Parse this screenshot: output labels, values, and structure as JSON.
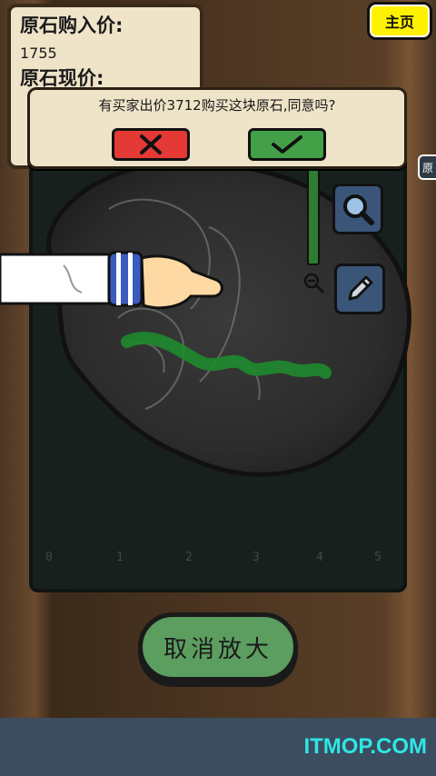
{
  "price_card": {
    "purchase_label": "原石购入价:",
    "purchase_value": "1755",
    "current_label": "原石现价:"
  },
  "home_button": {
    "label": "主页"
  },
  "side_tab": {
    "label": "原"
  },
  "dialog": {
    "message": "有买家出价3712购买这块原石,同意吗?"
  },
  "board": {
    "axis_labels": [
      "0",
      "1",
      "2",
      "3",
      "4",
      "5"
    ]
  },
  "cancel_zoom": {
    "label": "取消放大"
  },
  "footer": {
    "watermark": "ITMOP.COM"
  },
  "icons": {
    "reject": "close-icon",
    "accept": "checkmark-icon",
    "magnifier": "magnifier-icon",
    "pencil": "pencil-icon",
    "zoom_small": "zoom-out-icon"
  },
  "colors": {
    "reject": "#e53935",
    "accept": "#43a047",
    "home": "#fff200",
    "cancel_zoom": "#5b9e5f",
    "jade_vein": "#1e8a2e",
    "watermark": "#2ee6e6"
  }
}
